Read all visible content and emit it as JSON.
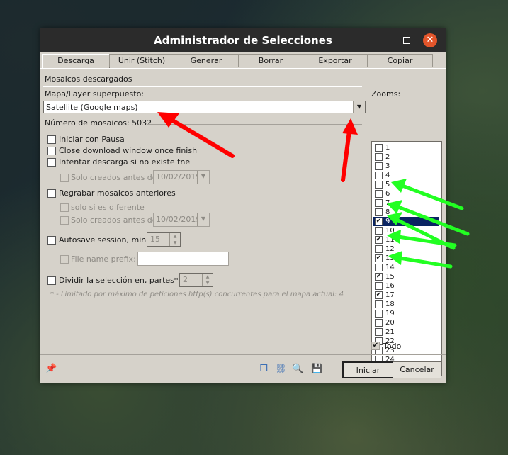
{
  "window": {
    "title": "Administrador de Selecciones"
  },
  "tabs": [
    "Descarga",
    "Unir (Stitch)",
    "Generar",
    "Borrar",
    "Exportar",
    "Copiar"
  ],
  "download": {
    "section_title": "Mosaicos descargados",
    "layer_label": "Mapa/Layer superpuesto:",
    "layer_value": "Satellite (Google maps)",
    "tile_count": "Número de mosaicos: 5032",
    "start_paused": "Iniciar con Pausa",
    "close_on_finish": "Close download window once finish",
    "retry_missing": "Intentar descarga si no existe tne",
    "only_created_before": "Solo creados antes de",
    "date_1": "10/02/2019",
    "rerecord": "Regrabar mosaicos anteriores",
    "only_if_different": "solo si es diferente",
    "date_2": "10/02/2019",
    "autosave": "Autosave session, min:",
    "autosave_value": "15",
    "file_prefix": "File name prefix:",
    "split": "Dividir la selección en, partes*:",
    "split_value": "2",
    "note": "* - Limitado por máximo de peticiones http(s) concurrentes para el mapa actual: 4"
  },
  "zooms": {
    "label": "Zooms:",
    "items": [
      {
        "label": "1",
        "checked": false
      },
      {
        "label": "2",
        "checked": false
      },
      {
        "label": "3",
        "checked": false
      },
      {
        "label": "4",
        "checked": false
      },
      {
        "label": "5",
        "checked": false
      },
      {
        "label": "6",
        "checked": false
      },
      {
        "label": "7",
        "checked": false
      },
      {
        "label": "8",
        "checked": false
      },
      {
        "label": "9",
        "checked": true
      },
      {
        "label": "10",
        "checked": false
      },
      {
        "label": "11",
        "checked": true
      },
      {
        "label": "12",
        "checked": false
      },
      {
        "label": "13",
        "checked": true
      },
      {
        "label": "14",
        "checked": false
      },
      {
        "label": "15",
        "checked": true
      },
      {
        "label": "16",
        "checked": false
      },
      {
        "label": "17",
        "checked": true
      },
      {
        "label": "18",
        "checked": false
      },
      {
        "label": "19",
        "checked": false
      },
      {
        "label": "20",
        "checked": false
      },
      {
        "label": "21",
        "checked": false
      },
      {
        "label": "22",
        "checked": false
      },
      {
        "label": "23",
        "checked": false
      },
      {
        "label": "24",
        "checked": false
      }
    ],
    "selected": "9",
    "all_label": "Todo"
  },
  "footer": {
    "start": "Iniciar",
    "cancel": "Cancelar"
  },
  "colors": {
    "selection": "#0a2462",
    "red_arrow": "#ff0000",
    "green_arrow": "#22ff22"
  }
}
